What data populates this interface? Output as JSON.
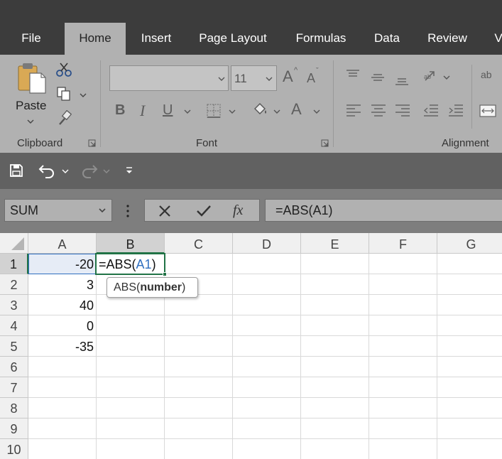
{
  "tabs": [
    "File",
    "Home",
    "Insert",
    "Page Layout",
    "Formulas",
    "Data",
    "Review",
    "V"
  ],
  "active_tab": "Home",
  "ribbon": {
    "clipboard": {
      "label": "Clipboard",
      "paste_label": "Paste"
    },
    "font": {
      "label": "Font",
      "font_name": "",
      "font_size": "11",
      "bold": "B",
      "italic": "I",
      "underline": "U",
      "increase_font": "A",
      "decrease_font": "A",
      "font_color": "A"
    },
    "alignment": {
      "label": "Alignment",
      "wrap_glyph": "ab"
    }
  },
  "formula_bar": {
    "name_box": "SUM",
    "fx": "fx",
    "formula": "=ABS(A1)"
  },
  "columns": [
    "A",
    "B",
    "C",
    "D",
    "E",
    "F",
    "G"
  ],
  "rows": [
    "1",
    "2",
    "3",
    "4",
    "5",
    "6",
    "7",
    "8",
    "9",
    "10"
  ],
  "cells": {
    "A": [
      "-20",
      "3",
      "40",
      "0",
      "-35"
    ],
    "B1": {
      "prefix": "=ABS(",
      "ref": "A1",
      "suffix": ")"
    }
  },
  "tooltip": {
    "func": "ABS(",
    "arg": "number",
    "close": ")"
  },
  "colors": {
    "accent_green": "#217346",
    "ref_blue": "#2f6fc0",
    "tab_bar": "#3c3c3c",
    "ribbon": "#b1b1b1"
  }
}
